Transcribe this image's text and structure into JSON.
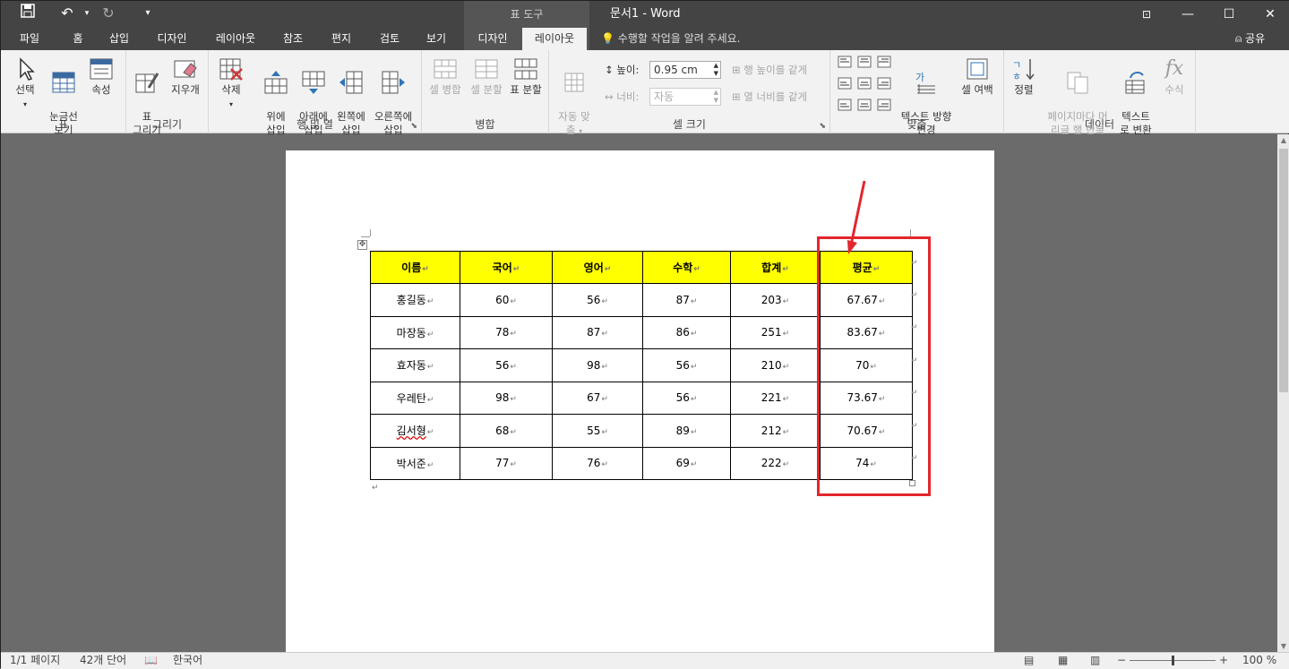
{
  "titlebar": {
    "title": "문서1 - Word",
    "context_tab": "표 도구"
  },
  "tabs": [
    {
      "label": "파일"
    },
    {
      "label": "홈"
    },
    {
      "label": "삽입"
    },
    {
      "label": "디자인"
    },
    {
      "label": "레이아웃"
    },
    {
      "label": "참조"
    },
    {
      "label": "편지"
    },
    {
      "label": "검토"
    },
    {
      "label": "보기"
    },
    {
      "label": "디자인"
    },
    {
      "label": "레이아웃",
      "active": true
    }
  ],
  "tellme": "수행할 작업을 알려 주세요.",
  "share": "공유",
  "ribbon": {
    "groups": {
      "table": "표",
      "draw": "그리기",
      "rowscols": "행 및 열",
      "merge": "병합",
      "cellsize": "셀 크기",
      "align": "맞춤",
      "data": "데이터"
    },
    "table": {
      "select": "선택",
      "gridlines": "눈금선\n보기",
      "properties": "속성"
    },
    "draw": {
      "draw_table": "표\n그리기",
      "eraser": "지우개"
    },
    "rowscols": {
      "delete": "삭제",
      "insert_above": "위에\n삽입",
      "insert_below": "아래에\n삽입",
      "insert_left": "왼쪽에\n삽입",
      "insert_right": "오른쪽에\n삽입"
    },
    "merge": {
      "merge_cells": "셀 병합",
      "split_cells": "셀 분할",
      "split_table": "표 분할"
    },
    "cellsize": {
      "autofit": "자동 맞\n춤",
      "height_label": "높이:",
      "height_value": "0.95 cm",
      "width_label": "너비:",
      "width_value": "자동",
      "distribute_rows": "행 높이를 같게",
      "distribute_cols": "열 너비를 같게"
    },
    "align": {
      "text_direction": "텍스트 방향\n변경",
      "cell_margins": "셀 여백"
    },
    "data": {
      "sort": "정렬",
      "repeat_header": "페이지마다 머\n리글 행 반복",
      "convert_text": "텍스트\n로 변환",
      "formula": "수식"
    }
  },
  "table": {
    "headers": [
      "이름",
      "국어",
      "영어",
      "수학",
      "합계",
      "평균"
    ],
    "rows": [
      [
        "홍길동",
        "60",
        "56",
        "87",
        "203",
        "67.67"
      ],
      [
        "마장동",
        "78",
        "87",
        "86",
        "251",
        "83.67"
      ],
      [
        "효자동",
        "56",
        "98",
        "56",
        "210",
        "70"
      ],
      [
        "우레탄",
        "98",
        "67",
        "56",
        "221",
        "73.67"
      ],
      [
        "김서형",
        "68",
        "55",
        "89",
        "212",
        "70.67"
      ],
      [
        "박서준",
        "77",
        "76",
        "69",
        "222",
        "74"
      ]
    ],
    "header_color": "#ffff00",
    "highlight_color": "#e3262c"
  },
  "status": {
    "page": "1/1 페이지",
    "words": "42개 단어",
    "language": "한국어",
    "zoom": "100 %"
  }
}
